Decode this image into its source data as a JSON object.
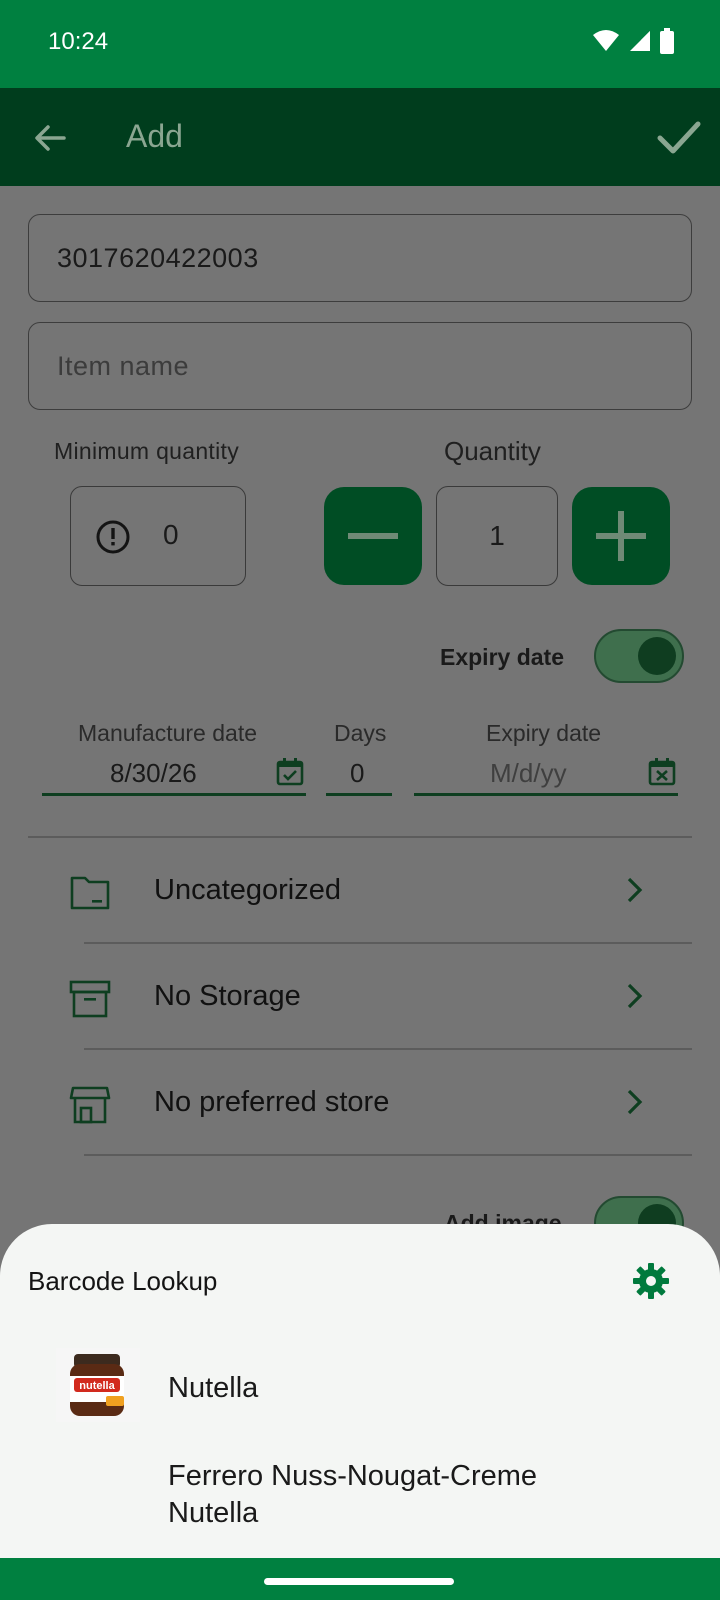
{
  "status_bar": {
    "time": "10:24"
  },
  "app_bar": {
    "title": "Add"
  },
  "form": {
    "barcode_value": "3017620422003",
    "item_name_placeholder": "Item name",
    "min_quantity_label": "Minimum quantity",
    "min_quantity_value": "0",
    "quantity_label": "Quantity",
    "quantity_value": "1",
    "expiry_toggle_label": "Expiry date",
    "manufacture_label": "Manufacture date",
    "manufacture_value": "8/30/26",
    "days_label": "Days",
    "days_value": "0",
    "expiry_label": "Expiry date",
    "expiry_placeholder": "M/d/yy",
    "category": "Uncategorized",
    "storage": "No Storage",
    "store": "No preferred store",
    "add_image_label": "Add image"
  },
  "sheet": {
    "title": "Barcode Lookup",
    "result_title": "Nutella",
    "result_subtitle": "Ferrero Nuss-Nougat-Creme Nutella",
    "thumb_text": "nutella"
  },
  "colors": {
    "primary": "#008040",
    "primary_dark": "#003d1d",
    "accent": "#007a3d"
  }
}
